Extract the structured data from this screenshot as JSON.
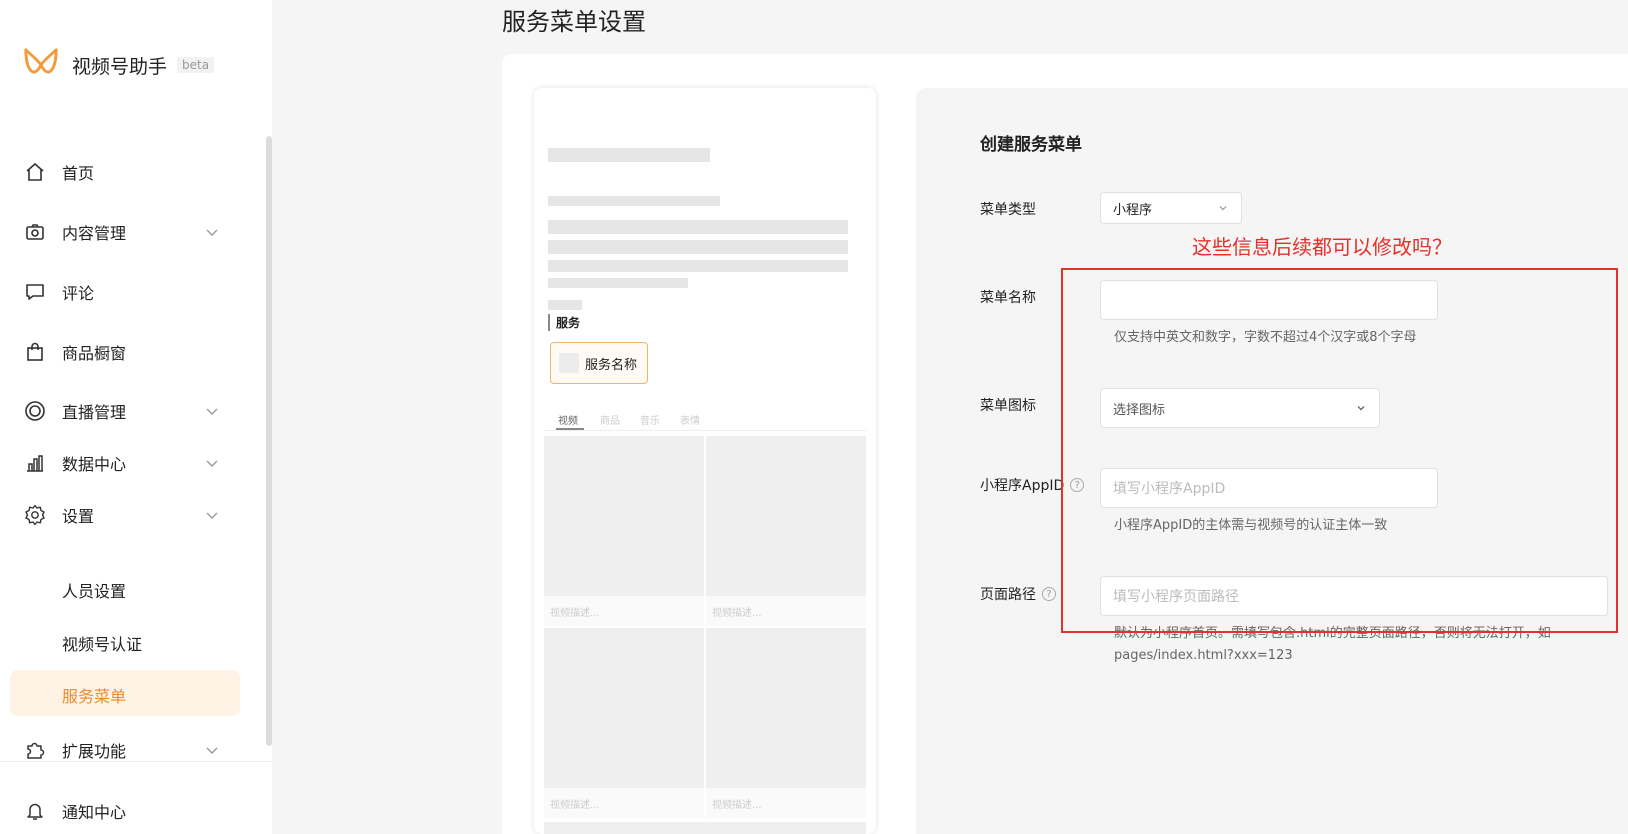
{
  "app": {
    "title": "视频号助手",
    "badge": "beta"
  },
  "sidebar": {
    "items": [
      {
        "label": "首页",
        "icon": "home-icon"
      },
      {
        "label": "内容管理",
        "icon": "camera-icon"
      },
      {
        "label": "评论",
        "icon": "comment-icon"
      },
      {
        "label": "商品橱窗",
        "icon": "shopping-bag-icon"
      },
      {
        "label": "直播管理",
        "icon": "live-icon"
      },
      {
        "label": "数据中心",
        "icon": "chart-icon"
      },
      {
        "label": "设置",
        "icon": "gear-icon"
      }
    ],
    "settings_sub": [
      "人员设置",
      "视频号认证",
      "服务菜单"
    ],
    "active_sub": "服务菜单",
    "more_items": [
      {
        "label": "扩展功能",
        "icon": "puzzle-icon"
      },
      {
        "label": "通知中心",
        "icon": "bell-icon"
      }
    ]
  },
  "page": {
    "title": "服务菜单设置"
  },
  "preview": {
    "service_section": "服务",
    "service_button": "服务名称",
    "tabs": [
      "视频",
      "商品",
      "音乐",
      "表情"
    ],
    "video_caption": "视频描述..."
  },
  "form": {
    "heading": "创建服务菜单",
    "menu_type": {
      "label": "菜单类型",
      "value": "小程序"
    },
    "menu_name": {
      "label": "菜单名称",
      "value": "",
      "hint": "仅支持中英文和数字，字数不超过4个汉字或8个字母"
    },
    "menu_icon": {
      "label": "菜单图标",
      "placeholder": "选择图标"
    },
    "appid": {
      "label": "小程序AppID",
      "placeholder": "填写小程序AppID",
      "hint": "小程序AppID的主体需与视频号的认证主体一致"
    },
    "path": {
      "label": "页面路径",
      "placeholder": "填写小程序页面路径",
      "hint_line1": "默认为小程序首页。需填写包含.html的完整页面路径，否则将无法打开，如",
      "hint_line2": "pages/index.html?xxx=123"
    }
  },
  "annotation": {
    "text": "这些信息后续都可以修改吗？",
    "color": "#e5312a"
  },
  "colors": {
    "accent": "#ee8a2d",
    "active_bg": "#fff3e6",
    "annotation": "#e5312a"
  }
}
